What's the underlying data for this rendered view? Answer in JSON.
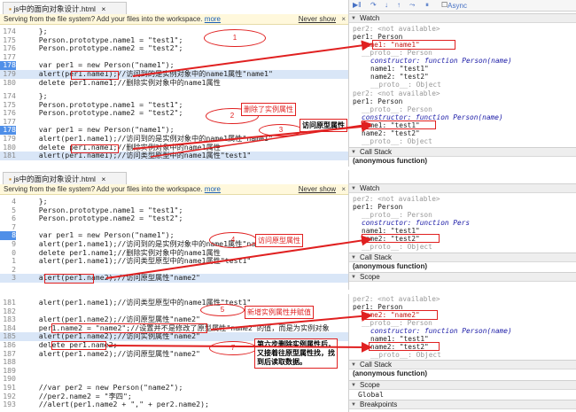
{
  "panel1": {
    "tab": "js中的面向对象设计.html",
    "notice": "Serving from the file system? Add your files into the workspace.",
    "more": "more",
    "never": "Never show",
    "lines": [
      {
        "n": "174",
        "t": "    };"
      },
      {
        "n": "175",
        "t": "    Person.prototype.name1 = \"test1\";"
      },
      {
        "n": "176",
        "t": "    Person.prototype.name2 = \"test2\";"
      },
      {
        "n": "177",
        "t": ""
      },
      {
        "n": "178",
        "t": "    var per1 = new Person(\"name1\");"
      },
      {
        "n": "179",
        "t": "    alert(per1.name1);//访问到的是实例对象中的name1属性\"name1\""
      },
      {
        "n": "180",
        "t": "    delete per1.name1;//删除实例对象中的name1属性"
      }
    ],
    "toolbar": {
      "async": "Async"
    },
    "watch": {
      "title": "Watch",
      "per2": "per2: <not available>",
      "per1": "per1: Person",
      "name1": "name1: \"name1\"",
      "proto": "__proto__: Person",
      "ctor": "constructor: function Person(name)",
      "pname1": "name1: \"test1\"",
      "pname2": "name2: \"test2\"",
      "pproto": "__proto__: Object"
    },
    "bubble": "1"
  },
  "panel2": {
    "lines": [
      {
        "n": "174",
        "t": "    };"
      },
      {
        "n": "175",
        "t": "    Person.prototype.name1 = \"test1\";"
      },
      {
        "n": "176",
        "t": "    Person.prototype.name2 = \"test2\";"
      },
      {
        "n": "177",
        "t": ""
      },
      {
        "n": "178",
        "t": "    var per1 = new Person(\"name1\");"
      },
      {
        "n": "179",
        "t": "    alert(per1.name1);//访问到的是实例对象中的name1属性\"name1\""
      },
      {
        "n": "180",
        "t": "    delete per1.name1;//删除实例对象中的name1属性"
      },
      {
        "n": "181",
        "t": "    alert(per1.name1);//访问类型原型中的name1属性\"test1\""
      }
    ],
    "watch": {
      "per2": "per2: <not available>",
      "per1": "per1: Person",
      "proto": "__proto__: Person",
      "ctor": "constructor: function Person(name)",
      "pname1": "name1: \"test1\"",
      "pname2": "name2: \"test2\"",
      "pproto": "__proto__: Object",
      "callstack": "Call Stack",
      "anon": "(anonymous function)"
    },
    "bubble2": "2",
    "bubble3": "3",
    "note_deleted": "删除了实例属性",
    "note_access": "访问原型属性"
  },
  "panel3": {
    "tab": "js中的面向对象设计.html",
    "notice": "Serving from the file system? Add your files into the workspace.",
    "more": "more",
    "never": "Never show",
    "lines": [
      {
        "n": "4",
        "t": "    };"
      },
      {
        "n": "5",
        "t": "    Person.prototype.name1 = \"test1\";"
      },
      {
        "n": "6",
        "t": "    Person.prototype.name2 = \"test2\";"
      },
      {
        "n": "7",
        "t": ""
      },
      {
        "n": "8",
        "t": "    var per1 = new Person(\"name1\");"
      },
      {
        "n": "9",
        "t": "    alert(per1.name1);//访问到的是实例对象中的name1属性\"name1\""
      },
      {
        "n": "0",
        "t": "    delete per1.name1;//删除实例对象中的name1属性"
      },
      {
        "n": "1",
        "t": "    alert(per1.name1);//访问类型原型中的name1属性\"test1\""
      },
      {
        "n": "2",
        "t": ""
      },
      {
        "n": "3",
        "t": "    alert(per1.name2);//访问原型属性\"name2\""
      }
    ],
    "watch": {
      "title": "Watch",
      "per2": "per2: <not available>",
      "per1": "per1: Person",
      "proto": "__proto__: Person",
      "ctor": "constructor: function Pers",
      "pname1": "name1: \"test1\"",
      "pname2": "name2: \"test2\"",
      "pproto": "__proto__: Object",
      "callstack": "Call Stack",
      "anon": "(anonymous function)",
      "scope": "Scope"
    },
    "bubble4": "4",
    "note_access": "访问原型属性"
  },
  "panel4": {
    "lines": [
      {
        "n": "181",
        "t": "    alert(per1.name1);//访问类型原型中的name1属性\"test1\""
      },
      {
        "n": "182",
        "t": ""
      },
      {
        "n": "183",
        "t": "    alert(per1.name2);//访问原型属性\"name2\""
      },
      {
        "n": "184",
        "t": "    per1.name2 = \"name2\";//设置并不是修改了原型属性\"name2\"的值，而是为实例对象"
      },
      {
        "n": "185",
        "t": "    alert(per1.name2);//访问实例属性\"name2\""
      },
      {
        "n": "186",
        "t": "    delete per1.name2;"
      },
      {
        "n": "187",
        "t": "    alert(per1.name2);//访问原型属性\"name2\""
      },
      {
        "n": "188",
        "t": ""
      },
      {
        "n": "189",
        "t": ""
      },
      {
        "n": "190",
        "t": ""
      },
      {
        "n": "191",
        "t": "    //var per2 = new Person(\"name2\");"
      },
      {
        "n": "192",
        "t": "    //per2.name2 = \"李四\";"
      },
      {
        "n": "193",
        "t": "    //alert(per1.name2 + \",\" + per2.name2);"
      }
    ],
    "watch": {
      "per2": "per2: <not available>",
      "per1": "per1: Person",
      "name2": "name2: \"name2\"",
      "proto": "__proto__: Person",
      "ctor": "constructor: function Person(name)",
      "pname1": "name1: \"test1\"",
      "pname2": "name2: \"test2\"",
      "pproto": "__proto__: Object",
      "callstack": "Call Stack",
      "anon": "(anonymous function)",
      "scope": "Scope",
      "global": "Global",
      "breakpoints": "Breakpoints"
    },
    "bubble5": "5",
    "bubble7": "7",
    "note_new": "新增实例属性并赋值",
    "note_step6": "第六步删除实例属性后，又接着往原型属性找，找到后读取数据。"
  }
}
